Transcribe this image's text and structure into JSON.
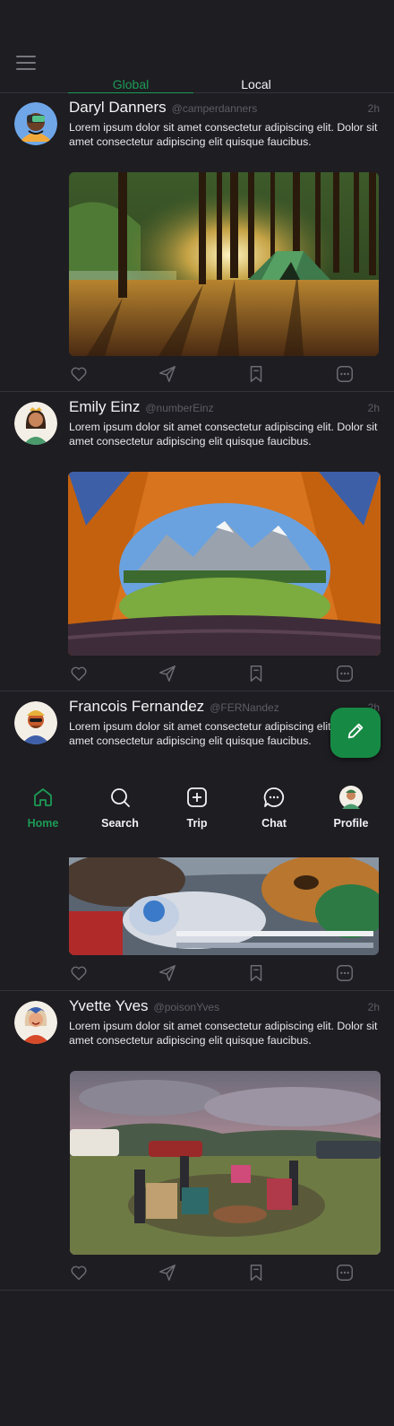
{
  "colors": {
    "accent": "#1c9b55",
    "background": "#1e1d22",
    "fab": "#168a44",
    "muted": "#5e5d64"
  },
  "tabs": [
    {
      "label": "Global",
      "active": true
    },
    {
      "label": "Local",
      "active": false
    }
  ],
  "posts": [
    {
      "name": "Daryl Danners",
      "handle": "@camperdanners",
      "time": "2h",
      "text": "Lorem ipsum dolor sit amet consectetur adipiscing elit. Dolor sit amet consectetur adipiscing elit quisque faucibus."
    },
    {
      "name": "Emily Einz",
      "handle": "@numberEinz",
      "time": "2h",
      "text": "Lorem ipsum dolor sit amet consectetur adipiscing elit. Dolor sit amet consectetur adipiscing elit quisque faucibus."
    },
    {
      "name": "Francois Fernandez",
      "handle": "@FERNandez",
      "time": "2h",
      "text": "Lorem ipsum dolor sit amet consectetur adipiscing elit. Dolor sit amet consectetur adipiscing elit quisque faucibus."
    },
    {
      "name": "Yvette Yves",
      "handle": "@poisonYves",
      "time": "2h",
      "text": "Lorem ipsum dolor sit amet consectetur adipiscing elit. Dolor sit amet consectetur adipiscing elit quisque faucibus."
    }
  ],
  "post_actions": [
    "heart-icon",
    "send-icon",
    "bookmark-icon",
    "more-icon"
  ],
  "fab": {
    "icon": "pencil-icon"
  },
  "nav": [
    {
      "label": "Home",
      "icon": "home-icon",
      "active": true
    },
    {
      "label": "Search",
      "icon": "search-icon",
      "active": false
    },
    {
      "label": "Trip",
      "icon": "add-square-icon",
      "active": false
    },
    {
      "label": "Chat",
      "icon": "chat-icon",
      "active": false
    },
    {
      "label": "Profile",
      "icon": "avatar",
      "active": false
    }
  ]
}
